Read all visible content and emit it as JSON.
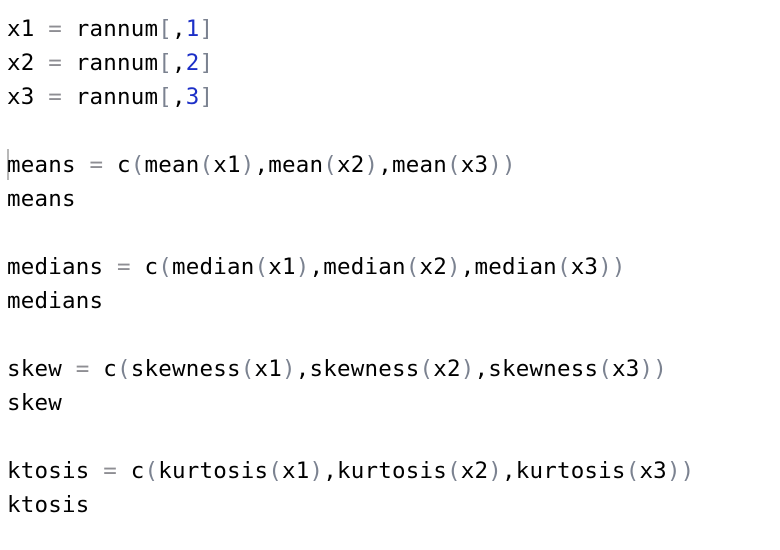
{
  "editor": {
    "lines": [
      {
        "tokens": [
          {
            "t": "x1",
            "k": "id"
          },
          {
            "t": " = ",
            "k": "op"
          },
          {
            "t": "rannum",
            "k": "id"
          },
          {
            "t": "[",
            "k": "paren"
          },
          {
            "t": ",",
            "k": "id"
          },
          {
            "t": "1",
            "k": "num"
          },
          {
            "t": "]",
            "k": "paren"
          }
        ]
      },
      {
        "tokens": [
          {
            "t": "x2",
            "k": "id"
          },
          {
            "t": " = ",
            "k": "op"
          },
          {
            "t": "rannum",
            "k": "id"
          },
          {
            "t": "[",
            "k": "paren"
          },
          {
            "t": ",",
            "k": "id"
          },
          {
            "t": "2",
            "k": "num"
          },
          {
            "t": "]",
            "k": "paren"
          }
        ]
      },
      {
        "tokens": [
          {
            "t": "x3",
            "k": "id"
          },
          {
            "t": " = ",
            "k": "op"
          },
          {
            "t": "rannum",
            "k": "id"
          },
          {
            "t": "[",
            "k": "paren"
          },
          {
            "t": ",",
            "k": "id"
          },
          {
            "t": "3",
            "k": "num"
          },
          {
            "t": "]",
            "k": "paren"
          }
        ]
      },
      {
        "tokens": []
      },
      {
        "tokens": [
          {
            "t": "means",
            "k": "id"
          },
          {
            "t": " = ",
            "k": "op"
          },
          {
            "t": "c",
            "k": "id"
          },
          {
            "t": "(",
            "k": "paren"
          },
          {
            "t": "mean",
            "k": "id"
          },
          {
            "t": "(",
            "k": "paren"
          },
          {
            "t": "x1",
            "k": "id"
          },
          {
            "t": ")",
            "k": "paren"
          },
          {
            "t": ",",
            "k": "id"
          },
          {
            "t": "mean",
            "k": "id"
          },
          {
            "t": "(",
            "k": "paren"
          },
          {
            "t": "x2",
            "k": "id"
          },
          {
            "t": ")",
            "k": "paren"
          },
          {
            "t": ",",
            "k": "id"
          },
          {
            "t": "mean",
            "k": "id"
          },
          {
            "t": "(",
            "k": "paren"
          },
          {
            "t": "x3",
            "k": "id"
          },
          {
            "t": "))",
            "k": "paren"
          }
        ]
      },
      {
        "tokens": [
          {
            "t": "means",
            "k": "id"
          }
        ]
      },
      {
        "tokens": []
      },
      {
        "tokens": [
          {
            "t": "medians",
            "k": "id"
          },
          {
            "t": " = ",
            "k": "op"
          },
          {
            "t": "c",
            "k": "id"
          },
          {
            "t": "(",
            "k": "paren"
          },
          {
            "t": "median",
            "k": "id"
          },
          {
            "t": "(",
            "k": "paren"
          },
          {
            "t": "x1",
            "k": "id"
          },
          {
            "t": ")",
            "k": "paren"
          },
          {
            "t": ",",
            "k": "id"
          },
          {
            "t": "median",
            "k": "id"
          },
          {
            "t": "(",
            "k": "paren"
          },
          {
            "t": "x2",
            "k": "id"
          },
          {
            "t": ")",
            "k": "paren"
          },
          {
            "t": ",",
            "k": "id"
          },
          {
            "t": "median",
            "k": "id"
          },
          {
            "t": "(",
            "k": "paren"
          },
          {
            "t": "x3",
            "k": "id"
          },
          {
            "t": "))",
            "k": "paren"
          }
        ]
      },
      {
        "tokens": [
          {
            "t": "medians",
            "k": "id"
          }
        ]
      },
      {
        "tokens": []
      },
      {
        "tokens": [
          {
            "t": "skew",
            "k": "id"
          },
          {
            "t": " = ",
            "k": "op"
          },
          {
            "t": "c",
            "k": "id"
          },
          {
            "t": "(",
            "k": "paren"
          },
          {
            "t": "skewness",
            "k": "id"
          },
          {
            "t": "(",
            "k": "paren"
          },
          {
            "t": "x1",
            "k": "id"
          },
          {
            "t": ")",
            "k": "paren"
          },
          {
            "t": ",",
            "k": "id"
          },
          {
            "t": "skewness",
            "k": "id"
          },
          {
            "t": "(",
            "k": "paren"
          },
          {
            "t": "x2",
            "k": "id"
          },
          {
            "t": ")",
            "k": "paren"
          },
          {
            "t": ",",
            "k": "id"
          },
          {
            "t": "skewness",
            "k": "id"
          },
          {
            "t": "(",
            "k": "paren"
          },
          {
            "t": "x3",
            "k": "id"
          },
          {
            "t": "))",
            "k": "paren"
          }
        ]
      },
      {
        "tokens": [
          {
            "t": "skew",
            "k": "id"
          }
        ]
      },
      {
        "tokens": []
      },
      {
        "tokens": [
          {
            "t": "ktosis",
            "k": "id"
          },
          {
            "t": " = ",
            "k": "op"
          },
          {
            "t": "c",
            "k": "id"
          },
          {
            "t": "(",
            "k": "paren"
          },
          {
            "t": "kurtosis",
            "k": "id"
          },
          {
            "t": "(",
            "k": "paren"
          },
          {
            "t": "x1",
            "k": "id"
          },
          {
            "t": ")",
            "k": "paren"
          },
          {
            "t": ",",
            "k": "id"
          },
          {
            "t": "kurtosis",
            "k": "id"
          },
          {
            "t": "(",
            "k": "paren"
          },
          {
            "t": "x2",
            "k": "id"
          },
          {
            "t": ")",
            "k": "paren"
          },
          {
            "t": ",",
            "k": "id"
          },
          {
            "t": "kurtosis",
            "k": "id"
          },
          {
            "t": "(",
            "k": "paren"
          },
          {
            "t": "x3",
            "k": "id"
          },
          {
            "t": "))",
            "k": "paren"
          }
        ]
      },
      {
        "tokens": [
          {
            "t": "ktosis",
            "k": "id"
          }
        ]
      }
    ]
  }
}
